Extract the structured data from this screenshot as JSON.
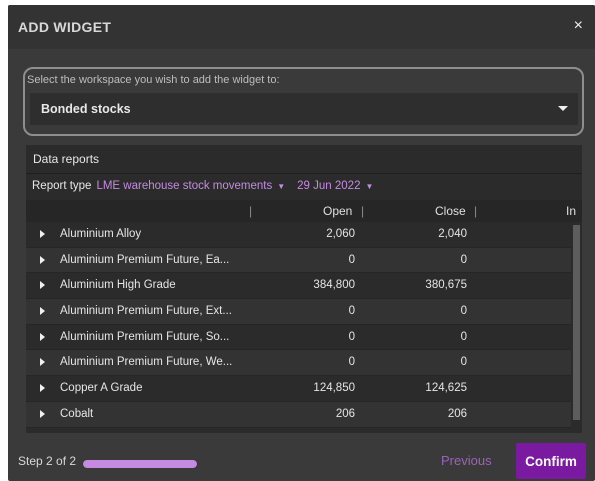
{
  "dialog": {
    "title": "ADD WIDGET",
    "close_symbol": "×"
  },
  "workspace": {
    "label": "Select the workspace you wish to add the widget to:",
    "selected": "Bonded stocks"
  },
  "report": {
    "panel_title": "Data reports",
    "type_label": "Report type",
    "type_value": "LME warehouse stock movements",
    "date_value": "29 Jun 2022",
    "columns": {
      "open": "Open",
      "close": "Close",
      "in": "In"
    },
    "rows": [
      {
        "name": "Aluminium Alloy",
        "open": "2,060",
        "close": "2,040"
      },
      {
        "name": "Aluminium Premium Future, Ea...",
        "open": "0",
        "close": "0"
      },
      {
        "name": "Aluminium High Grade",
        "open": "384,800",
        "close": "380,675"
      },
      {
        "name": "Aluminium Premium Future, Ext...",
        "open": "0",
        "close": "0"
      },
      {
        "name": "Aluminium Premium Future, So...",
        "open": "0",
        "close": "0"
      },
      {
        "name": "Aluminium Premium Future, We...",
        "open": "0",
        "close": "0"
      },
      {
        "name": "Copper A Grade",
        "open": "124,850",
        "close": "124,625"
      },
      {
        "name": "Cobalt",
        "open": "206",
        "close": "206"
      }
    ]
  },
  "footer": {
    "step_text": "Step 2 of 2",
    "progress_fraction": 1.0,
    "previous_label": "Previous",
    "confirm_label": "Confirm"
  },
  "colors": {
    "accent": "#7a1aa1",
    "accent_light": "#c58be0"
  }
}
